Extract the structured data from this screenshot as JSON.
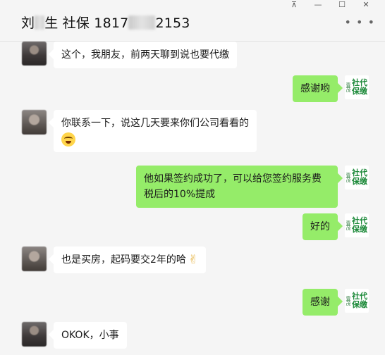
{
  "header": {
    "title_part1": "刘",
    "title_part2": "生 社保 1817",
    "title_part3": "2153",
    "more_icon": "more-dots-icon",
    "window_controls": {
      "pin": "pin-icon",
      "minimize": "minimize-icon",
      "maximize": "maximize-icon",
      "close": "close-icon"
    }
  },
  "brand_avatar": {
    "small_text": "壹茂",
    "big_text": "社代保缴"
  },
  "messages": [
    {
      "side": "left",
      "text": "这个，我朋友，前两天聊到说也要代缴"
    },
    {
      "side": "right",
      "text": "感谢哟"
    },
    {
      "side": "left",
      "text": "你联系一下，说这几天要来你们公司看看的",
      "emoji": "crying-laughing-emoji"
    },
    {
      "side": "right",
      "text": "他如果签约成功了，可以给您签约服务费税后的10%提成"
    },
    {
      "side": "right",
      "text": "好的"
    },
    {
      "side": "left",
      "text": "也是买房，起码要交2年的哈",
      "emoji": "victory-hand-emoji",
      "emoji_char": "✌"
    },
    {
      "side": "right",
      "text": "感谢"
    },
    {
      "side": "left",
      "text": "OKOK，小事"
    }
  ]
}
